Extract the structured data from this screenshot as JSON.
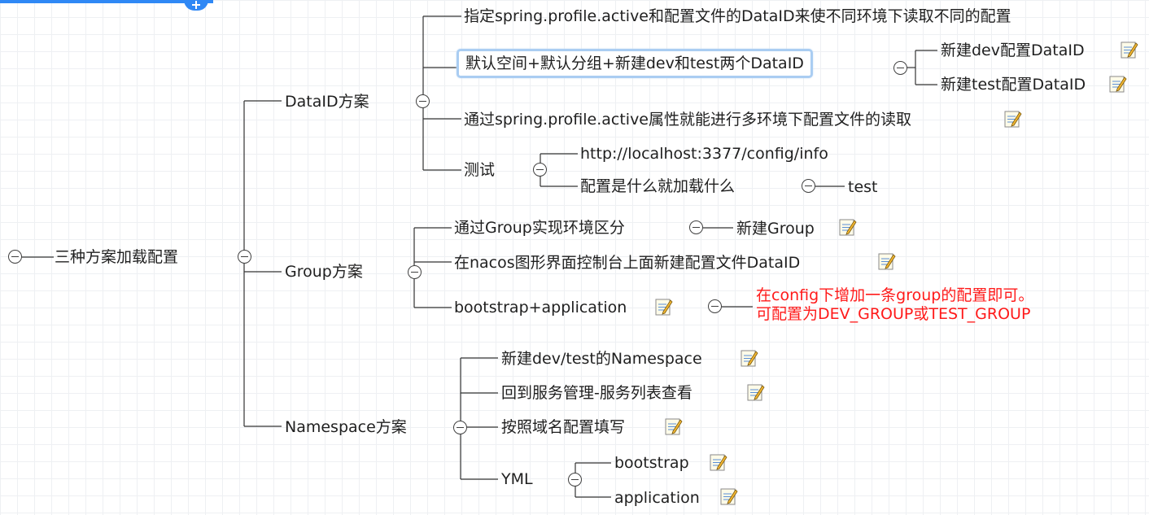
{
  "mindmap": {
    "root": "三种方案加载配置",
    "branches": {
      "dataid": {
        "title": "DataID方案",
        "items": {
          "d1": "指定spring.profile.active和配置文件的DataID来使不同环境下读取不同的配置",
          "d2": "默认空间+默认分组+新建dev和test两个DataID",
          "d2a": "新建dev配置DataID",
          "d2b": "新建test配置DataID",
          "d3": "通过spring.profile.active属性就能进行多环境下配置文件的读取",
          "d4": "测试",
          "d4a": "http://localhost:3377/config/info",
          "d4b": "配置是什么就加载什么",
          "d4b1": "test"
        }
      },
      "group": {
        "title": "Group方案",
        "items": {
          "g1": "通过Group实现环境区分",
          "g1a": "新建Group",
          "g2": "在nacos图形界面控制台上面新建配置文件DataID",
          "g3": "bootstrap+application",
          "g3a_line1": "在config下增加一条group的配置即可。",
          "g3a_line2": "可配置为DEV_GROUP或TEST_GROUP"
        }
      },
      "namespace": {
        "title": "Namespace方案",
        "items": {
          "n1": "新建dev/test的Namespace",
          "n2": "回到服务管理-服务列表查看",
          "n3": "按照域名配置填写",
          "n4": "YML",
          "n4a": "bootstrap",
          "n4b": "application"
        }
      }
    }
  },
  "colors": {
    "line": "#333333",
    "note_text": "#ff1a1a",
    "selection": "#aacdf2",
    "accent": "#2f88f5"
  },
  "icons": {
    "note": "note-icon",
    "collapse": "collapse-icon",
    "add": "plus-icon"
  }
}
